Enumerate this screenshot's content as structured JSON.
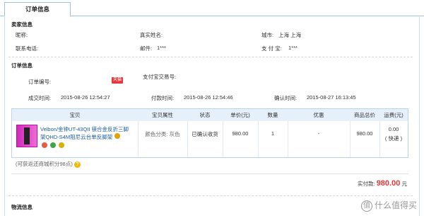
{
  "tab": {
    "label": "订单信息"
  },
  "seller": {
    "section_title": "卖家信息",
    "nickname_label": "昵称:",
    "realname_label": "真实姓名:",
    "city_label": "城市:",
    "city_value": "上海 上海",
    "phone_label": "联系电话:",
    "email_label": "邮件:",
    "email_value": "1***",
    "alipay_label": "支 付 宝:",
    "alipay_value": "1***"
  },
  "order": {
    "section_title": "订单信息",
    "order_no_label": "订单编号:",
    "tmall_tag": "天猫",
    "alipay_tx_label": "支付宝交易号:",
    "created_label": "成交时间:",
    "created_value": "2015-08-26 12:54:27",
    "paid_label": "付款时间:",
    "paid_value": "2015-08-26 12:54:46",
    "confirmed_label": "确认时间:",
    "confirmed_value": "2015-08-27 16:13:45"
  },
  "table": {
    "headers": [
      "宝贝",
      "宝贝属性",
      "状态",
      "单价(元)",
      "数量",
      "优惠",
      "商品总价(元)",
      "运费(元)"
    ],
    "row": {
      "title_line1": "Velbon/金钟UT-43QII 镁合金反折三脚",
      "title_line2": "架QHD-S4M阻尼云台单反脚架",
      "attribute": "颜色分类: 灰色",
      "status": "已确认收货",
      "unit_price": "980.00",
      "quantity": "1",
      "discount": "-",
      "subtotal": "980.00",
      "shipping": "0.00",
      "shipping_method": "( 快递 )"
    }
  },
  "points_hint": "(可获返还商城积分98点)",
  "payment": {
    "label": "实付款:",
    "amount": "980.00",
    "unit": "元"
  },
  "logistics": {
    "section_title": "物流信息"
  },
  "watermark": {
    "icon": "值",
    "text": "什么值得买"
  },
  "colors": {
    "accent_red": "#e4393c",
    "table_header_bg": "#e6f0fb",
    "border_blue": "#9fc3e6"
  }
}
